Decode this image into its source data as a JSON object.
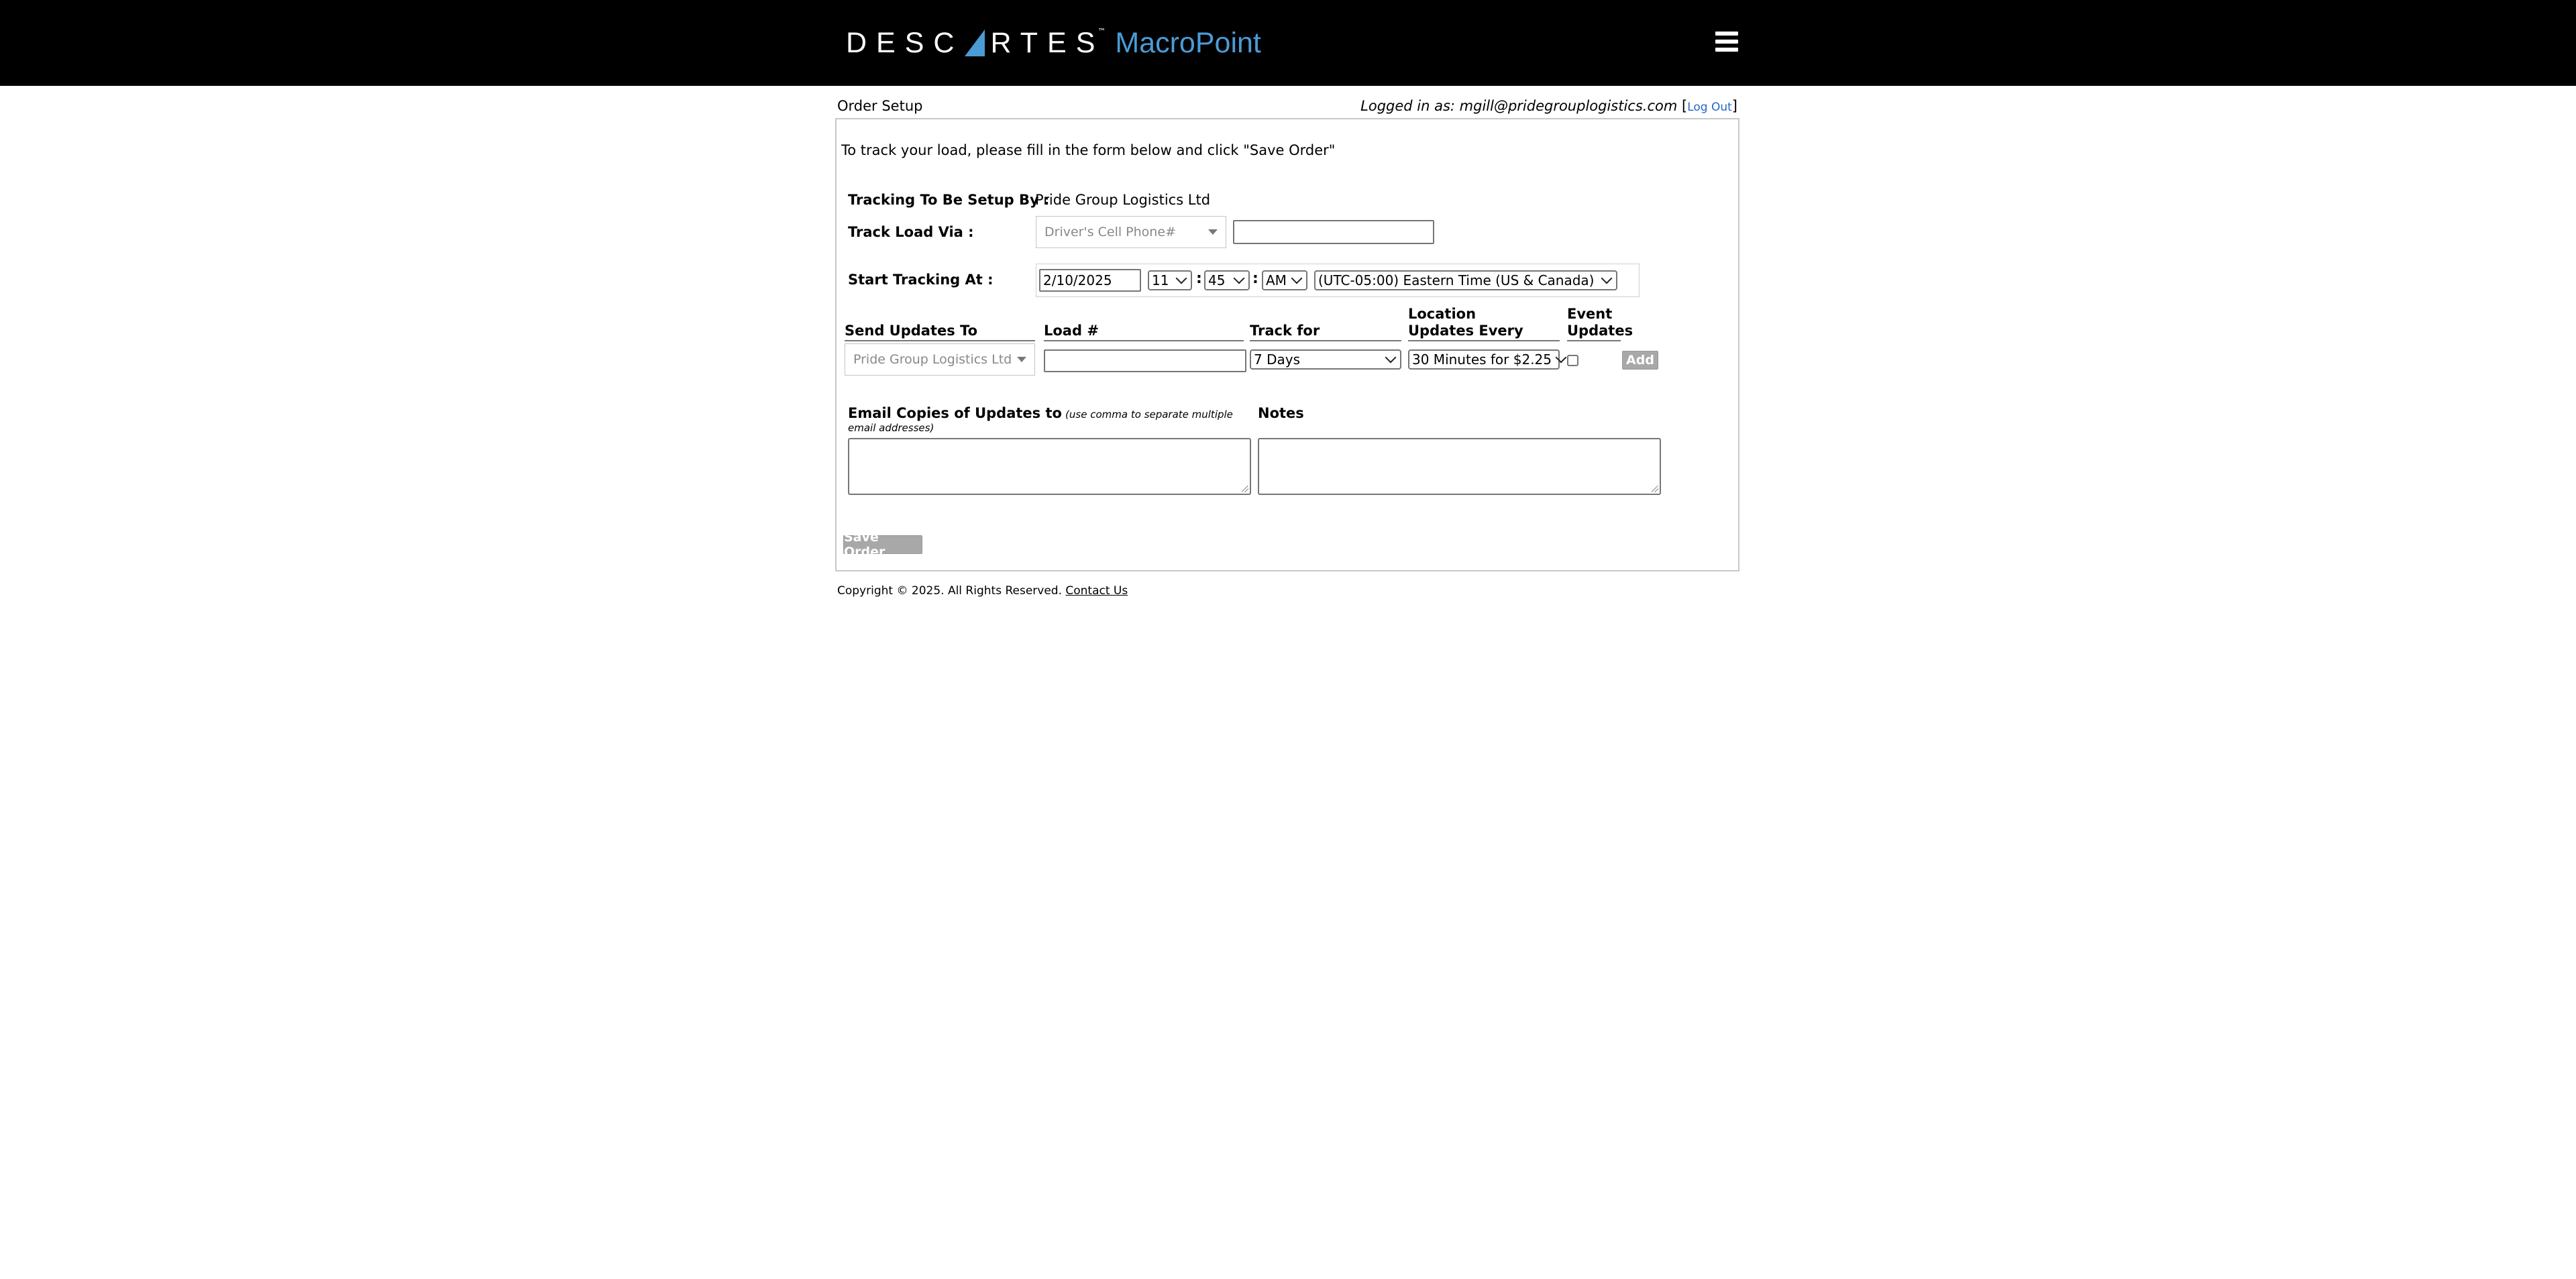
{
  "brand": {
    "name": "DESCARTES",
    "product": "MacroPoint",
    "trademark": "™"
  },
  "header": {
    "page_title": "Order Setup",
    "logged_in_label": "Logged in as: mgill@pridegrouplogistics.com",
    "logout_open": "[",
    "logout_label": "Log Out",
    "logout_close": "]"
  },
  "form": {
    "intro": "To track your load, please fill in the form below and click \"Save Order\"",
    "setup_by_label": "Tracking To Be Setup By :",
    "setup_by_value": "Pride Group Logistics Ltd",
    "track_via_label": "Track Load Via :",
    "track_via_selected": "Driver's Cell Phone#",
    "track_via_input_value": "",
    "start_label": "Start Tracking At :",
    "start_date": "2/10/2025",
    "start_hour": "11",
    "start_minute": "45",
    "start_ampm": "AM",
    "time_sep": ":",
    "timezone": "(UTC-05:00) Eastern Time (US & Canada)"
  },
  "updates_table": {
    "headers": {
      "send_to": "Send Updates To",
      "load": "Load #",
      "track_for": "Track for",
      "location_line1": "Location",
      "location_line2": "Updates Every",
      "event_line1": "Event",
      "event_line2": "Updates"
    },
    "row": {
      "send_to": "Pride Group Logistics Ltd",
      "load": "",
      "track_for": "7 Days",
      "location_every": "30 Minutes for $2.25",
      "event_updates_checked": false,
      "add_label": "Add"
    }
  },
  "email_section": {
    "label": "Email Copies of Updates to",
    "note": "(use comma to separate multiple email addresses)",
    "value": ""
  },
  "notes_section": {
    "label": "Notes",
    "value": ""
  },
  "save_button": "Save Order",
  "footer": {
    "copyright": "Copyright © 2025. All Rights Reserved.",
    "contact_link": "Contact Us"
  },
  "colors": {
    "topbar": "#000000",
    "product_blue": "#4a9bd6",
    "link_blue": "#2266cc",
    "disabled_button": "#a8a8a8"
  }
}
